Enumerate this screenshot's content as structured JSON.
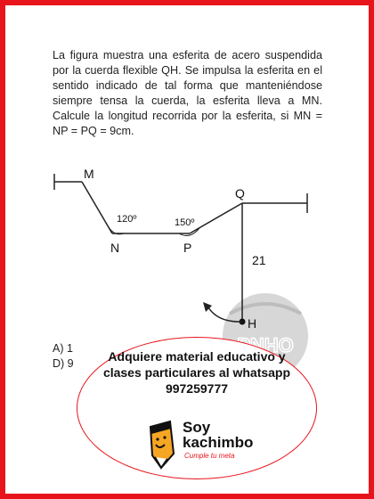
{
  "problem": {
    "text": "La figura muestra una esferita de acero suspendida por la cuerda flexible QH. Se impulsa la esferita en el sentido indicado de tal forma que manteniéndose siempre tensa la cuerda, la esferita lleva a MN. Calcule la longitud recorrida por la esferita, si MN = NP = PQ = 9cm."
  },
  "figure": {
    "labels": {
      "M": "M",
      "N": "N",
      "P": "P",
      "Q": "Q",
      "H": "H",
      "angle_n": "120º",
      "angle_p": "150º",
      "length_qh": "21"
    },
    "watermark": "PNHO",
    "colors": {
      "watermark": "#c9c9c9"
    }
  },
  "options": {
    "a": "A) 1",
    "d": "D) 9"
  },
  "promo": {
    "text": "Adquiere material educativo y clases particulares al whatsapp 997259777",
    "brand_name": "Soy kachimbo",
    "tagline": "Cumple tu meta",
    "colors": {
      "accent": "#e8141b",
      "pencil": "#f5a623"
    }
  },
  "frame": {
    "color": "#e8141b"
  }
}
